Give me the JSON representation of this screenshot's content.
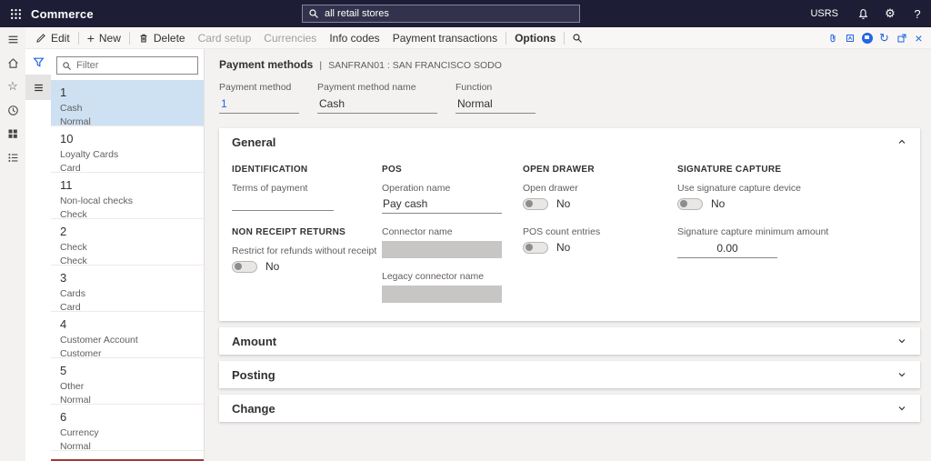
{
  "topbar": {
    "app_name": "Commerce",
    "search_text": "all retail stores",
    "user": "USRS"
  },
  "icons": {
    "gear": "⚙",
    "help": "?",
    "refresh": "↻",
    "close": "×",
    "plus": "+",
    "star": "☆"
  },
  "actionbar": {
    "edit": "Edit",
    "new": "New",
    "delete": "Delete",
    "card_setup": "Card setup",
    "currencies": "Currencies",
    "info_codes": "Info codes",
    "payment_transactions": "Payment transactions",
    "options": "Options"
  },
  "list_panel": {
    "filter_placeholder": "Filter",
    "items": [
      {
        "id": "1",
        "name": "Cash",
        "type": "Normal"
      },
      {
        "id": "10",
        "name": "Loyalty Cards",
        "type": "Card"
      },
      {
        "id": "11",
        "name": "Non-local checks",
        "type": "Check"
      },
      {
        "id": "2",
        "name": "Check",
        "type": "Check"
      },
      {
        "id": "3",
        "name": "Cards",
        "type": "Card"
      },
      {
        "id": "4",
        "name": "Customer Account",
        "type": "Customer"
      },
      {
        "id": "5",
        "name": "Other",
        "type": "Normal"
      },
      {
        "id": "6",
        "name": "Currency",
        "type": "Normal"
      }
    ]
  },
  "page": {
    "title": "Payment methods",
    "separator": "|",
    "context": "SANFRAN01 : SAN FRANCISCO SODO"
  },
  "header_fields": {
    "payment_method": {
      "label": "Payment method",
      "value": "1"
    },
    "payment_method_name": {
      "label": "Payment method name",
      "value": "Cash"
    },
    "function": {
      "label": "Function",
      "value": "Normal"
    }
  },
  "general": {
    "title": "General",
    "identification": {
      "group": "IDENTIFICATION",
      "terms_label": "Terms of payment"
    },
    "non_receipt": {
      "group": "NON RECEIPT RETURNS",
      "restrict_label": "Restrict for refunds without receipt",
      "restrict_value": "No"
    },
    "pos": {
      "group": "POS",
      "operation_label": "Operation name",
      "operation_value": "Pay cash",
      "connector_label": "Connector name",
      "legacy_label": "Legacy connector name"
    },
    "open_drawer": {
      "group": "OPEN DRAWER",
      "open_drawer_label": "Open drawer",
      "open_drawer_value": "No",
      "pos_count_label": "POS count entries",
      "pos_count_value": "No"
    },
    "signature": {
      "group": "SIGNATURE CAPTURE",
      "device_label": "Use signature capture device",
      "device_value": "No",
      "min_amount_label": "Signature capture minimum amount",
      "min_amount_value": "0.00"
    }
  },
  "sections": {
    "amount": "Amount",
    "posting": "Posting",
    "change": "Change"
  }
}
